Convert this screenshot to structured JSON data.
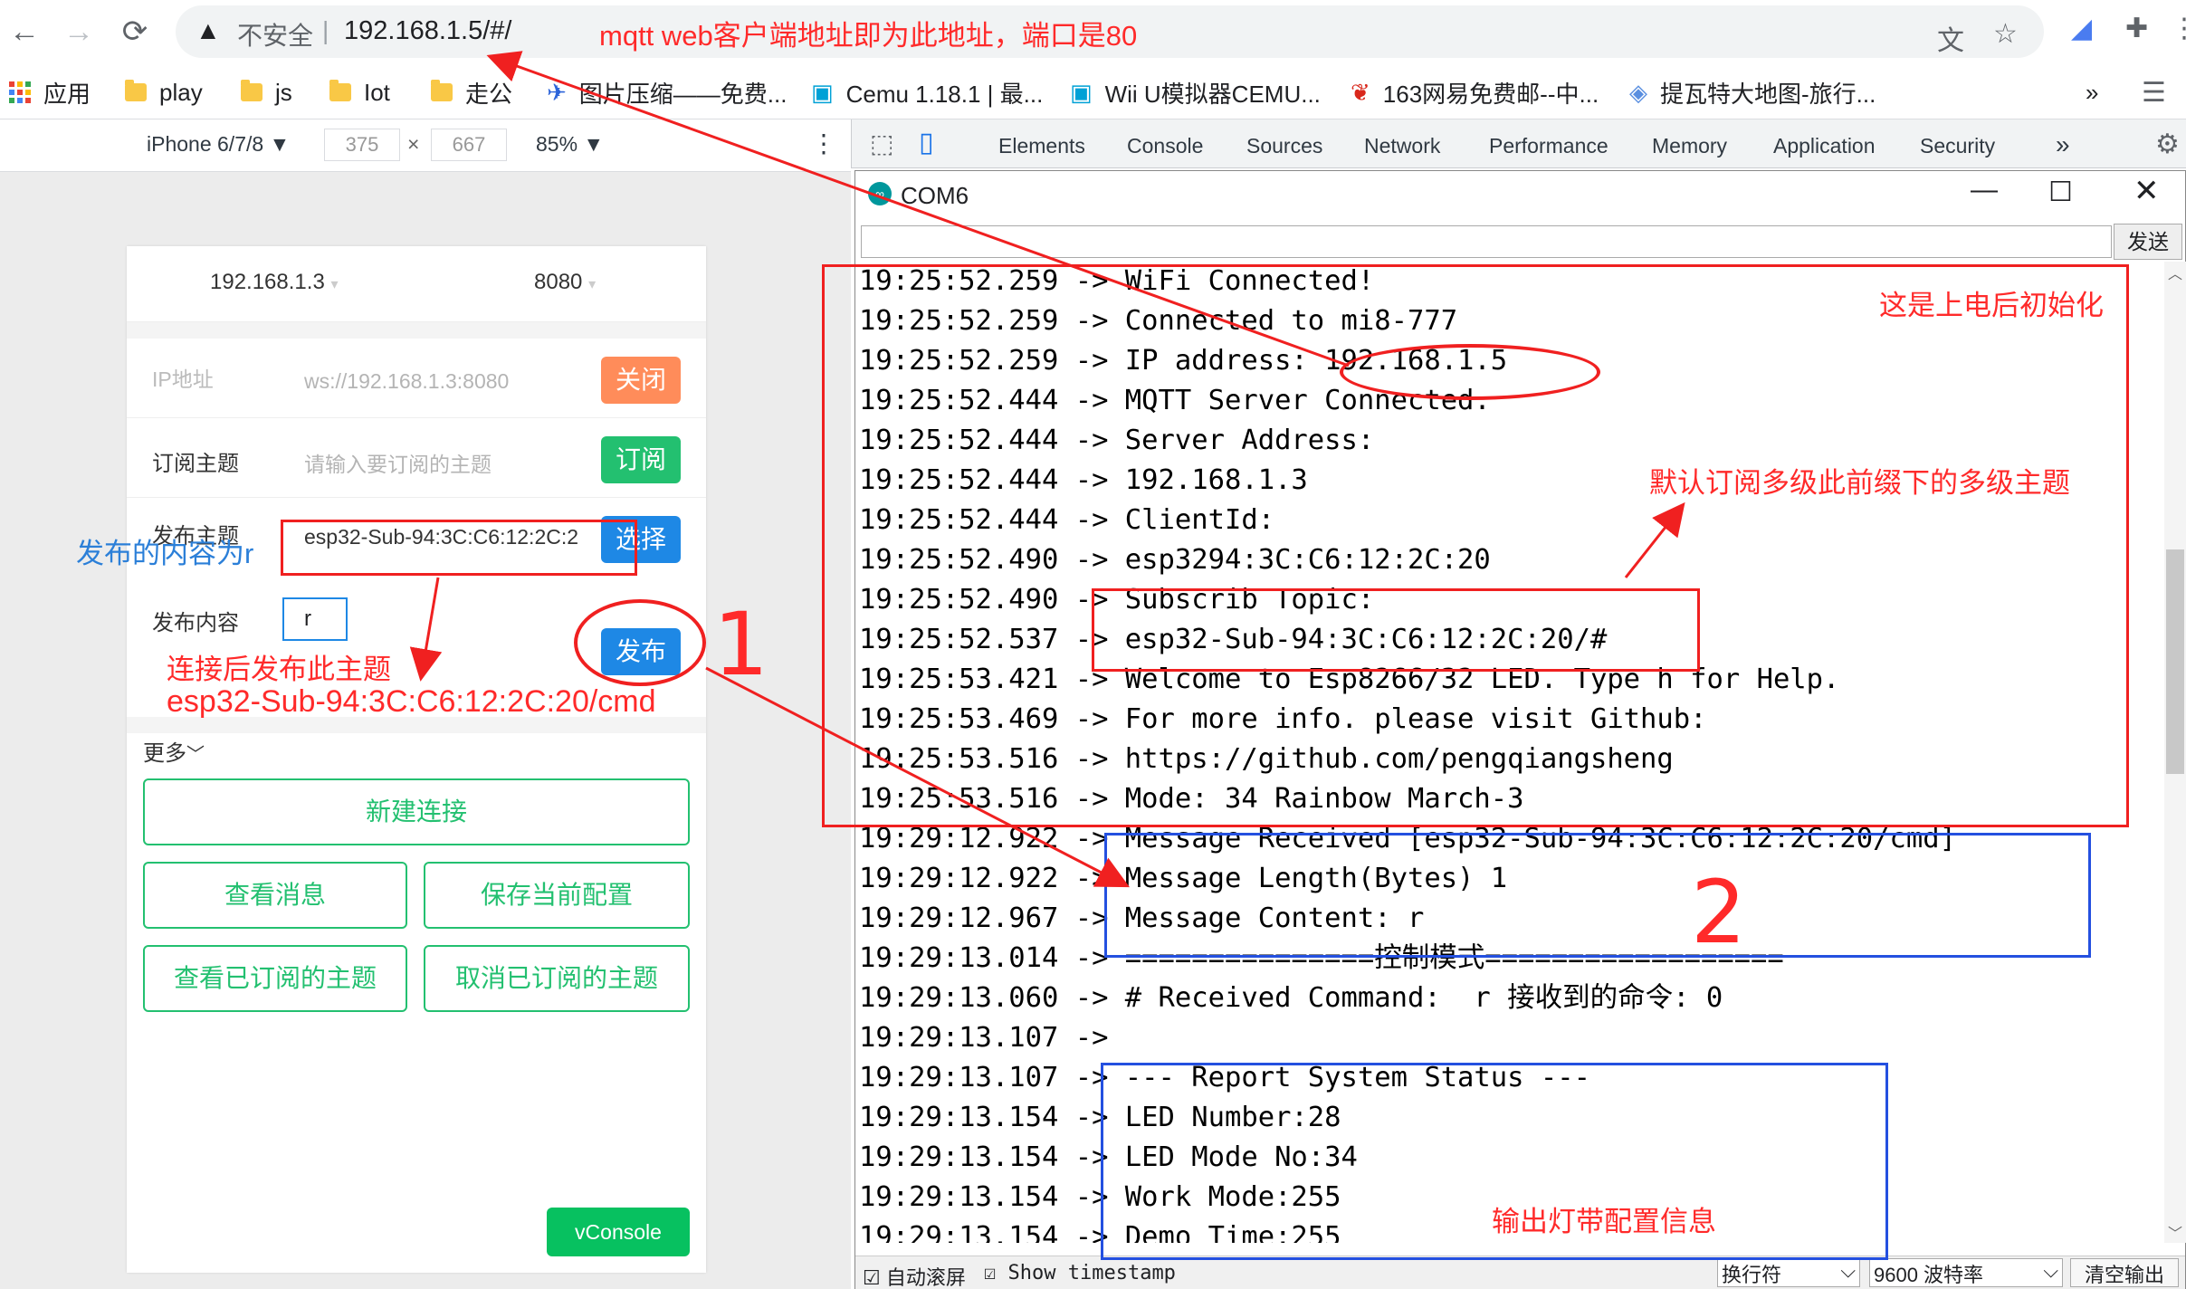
{
  "browser": {
    "url": "192.168.1.5/#/",
    "insecure_label": "不安全",
    "bookmarks": [
      "应用",
      "play",
      "js",
      "Iot",
      "走公",
      "图片压缩——免费...",
      "Cemu 1.18.1 | 最...",
      "Wii U模拟器CEMU...",
      "163网易免费邮--中...",
      "提瓦特大地图-旅行..."
    ],
    "more": "»"
  },
  "device": {
    "name": "iPhone 6/7/8 ▼",
    "width": "375",
    "height": "667",
    "zoom": "85% ▼",
    "times": "×"
  },
  "app": {
    "ip": "192.168.1.3",
    "port": "8080",
    "ip_label": "IP地址",
    "ip_value": "ws://192.168.1.3:8080",
    "close_btn": "关闭",
    "sub_label": "订阅主题",
    "sub_placeholder": "请输入要订阅的主题",
    "sub_btn": "订阅",
    "pub_label": "发布主题",
    "pub_topic": "esp32-Sub-94:3C:C6:12:2C:2",
    "select_btn": "选择",
    "content_label": "发布内容",
    "content_value": "r",
    "publish_btn": "发布",
    "more": "更多",
    "new_conn": "新建连接",
    "view_msg": "查看消息",
    "save_cfg": "保存当前配置",
    "view_subs": "查看已订阅的主题",
    "cancel_subs": "取消已订阅的主题",
    "vconsole": "vConsole"
  },
  "devtools": {
    "tabs": [
      "Elements",
      "Console",
      "Sources",
      "Network",
      "Performance",
      "Memory",
      "Application",
      "Security"
    ],
    "more": "»"
  },
  "serial": {
    "title": "COM6",
    "send_btn": "发送",
    "autoscroll": "自动滚屏",
    "show_ts": "Show timestamp",
    "line_ending": "换行符",
    "baud": "9600 波特率",
    "clear": "清空输出",
    "lines": [
      "19:25:52.259 -> WiFi Connected!",
      "19:25:52.259 -> Connected to mi8-777",
      "19:25:52.259 -> IP address: 192.168.1.5",
      "19:25:52.444 -> MQTT Server Connected.",
      "19:25:52.444 -> Server Address:",
      "19:25:52.444 -> 192.168.1.3",
      "19:25:52.444 -> ClientId:",
      "19:25:52.490 -> esp3294:3C:C6:12:2C:20",
      "19:25:52.490 -> Subscrib Topic:",
      "19:25:52.537 -> esp32-Sub-94:3C:C6:12:2C:20/#",
      "19:25:53.421 -> Welcome to Esp8266/32 LED. Type h for Help.",
      "19:25:53.469 -> For more info. please visit Github:",
      "19:25:53.516 -> https://github.com/pengqiangsheng",
      "19:25:53.516 -> Mode: 34 Rainbow March-3",
      "19:29:12.922 -> Message Received [esp32-Sub-94:3C:C6:12:2C:20/cmd]",
      "19:29:12.922 -> Message Length(Bytes) 1",
      "19:29:12.967 -> Message Content: r",
      "19:29:13.014 -> ===============控制模式==================",
      "19:29:13.060 -> # Received Command:  r 接收到的命令: 0",
      "19:29:13.107 ->",
      "19:29:13.107 -> --- Report System Status ---",
      "19:29:13.154 -> LED Number:28",
      "19:29:13.154 -> LED Mode No:34",
      "19:29:13.154 -> Work Mode:255",
      "19:29:13.154 -> Demo Time:255"
    ]
  },
  "annotations": {
    "url_note": "mqtt web客户端地址即为此地址，端口是80",
    "init": "这是上电后初始化",
    "subscribe": "默认订阅多级此前缀下的多级主题",
    "content": "发布的内容为r",
    "publish_topic_1": "连接后发布此主题",
    "publish_topic_2": "esp32-Sub-94:3C:C6:12:2C:20/cmd",
    "step1": "1",
    "step2": "2",
    "led_info": "输出灯带配置信息"
  },
  "colors": {
    "annotation_red": "#ff2a2a",
    "annotation_blue": "#2b7fd8",
    "green": "#23c070",
    "orange": "#ff8c5a",
    "blue_btn": "#1e88e5"
  }
}
